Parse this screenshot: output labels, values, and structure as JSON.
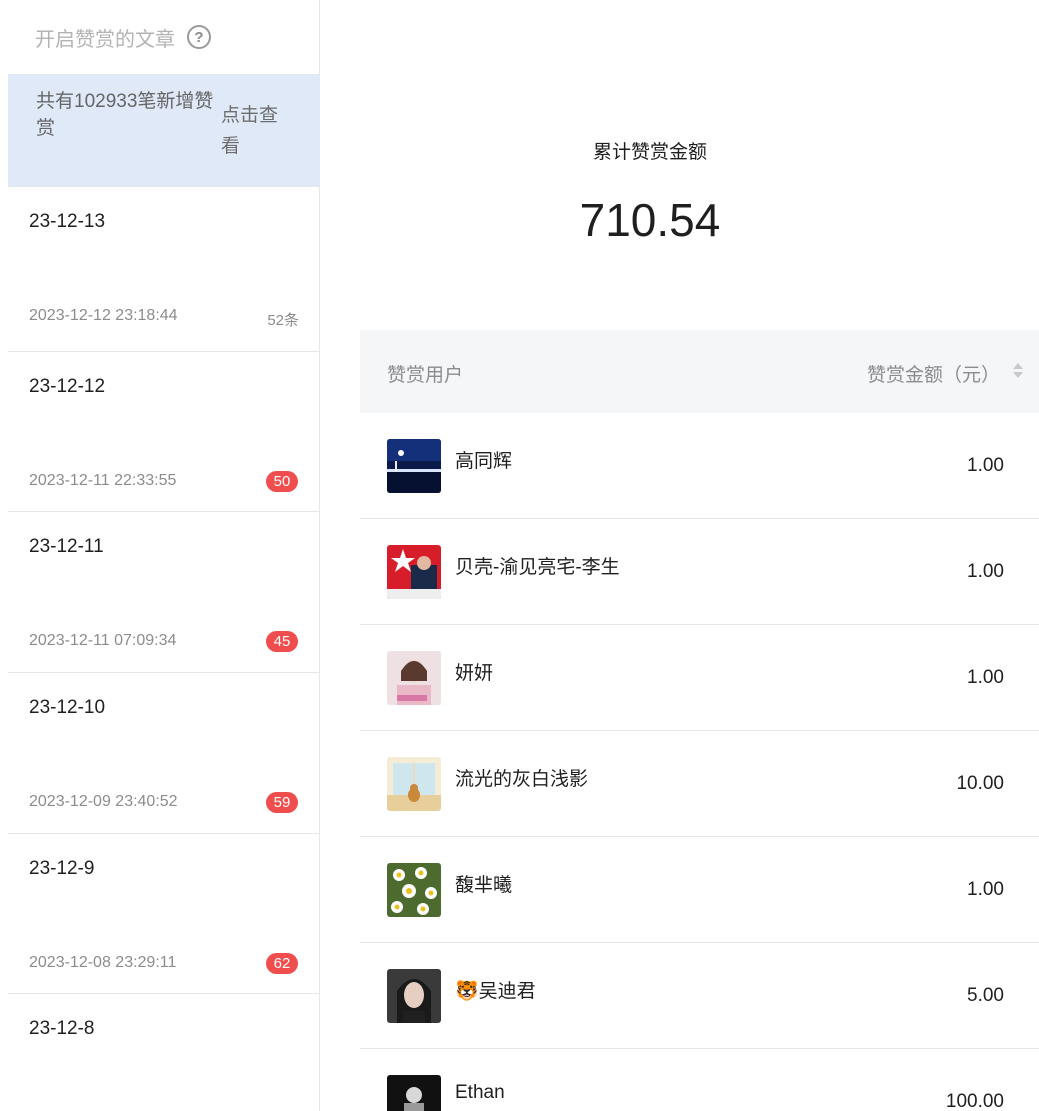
{
  "sidebar": {
    "title": "开启赞赏的文章",
    "help_icon": "question-circle-icon",
    "notice_text": "共有102933笔新增赞赏",
    "notice_link": "点击查看",
    "articles": [
      {
        "title": "23-12-13",
        "time": "2023-12-12 23:18:44",
        "count": "52条"
      },
      {
        "title": "23-12-12",
        "time": "2023-12-11 22:33:55",
        "badge": "50"
      },
      {
        "title": "23-12-11",
        "time": "2023-12-11 07:09:34",
        "badge": "45"
      },
      {
        "title": "23-12-10",
        "time": "2023-12-09 23:40:52",
        "badge": "59"
      },
      {
        "title": "23-12-9",
        "time": "2023-12-08 23:29:11",
        "badge": "62"
      },
      {
        "title": "23-12-8"
      }
    ]
  },
  "summary": {
    "label": "累计赞赏金额",
    "value": "710.54"
  },
  "table": {
    "col_user": "赞赏用户",
    "col_amount": "赞赏金额（元）",
    "rows": [
      {
        "name": "高同辉",
        "amount": "1.00",
        "avatar": "night-bridge-avatar"
      },
      {
        "name": "贝壳-渝见亮宅-李生",
        "amount": "1.00",
        "avatar": "agent-poster-avatar"
      },
      {
        "name": "妍妍",
        "amount": "1.00",
        "avatar": "girl-photo-avatar"
      },
      {
        "name": "流光的灰白浅影",
        "amount": "10.00",
        "avatar": "cat-window-avatar"
      },
      {
        "name": "馥芈曦",
        "amount": "1.00",
        "avatar": "daisy-flowers-avatar"
      },
      {
        "name": "🐯吴迪君",
        "amount": "5.00",
        "avatar": "woman-portrait-avatar"
      },
      {
        "name": "Ethan",
        "amount": "100.00",
        "avatar": "dark-photo-avatar"
      }
    ]
  },
  "colors": {
    "notice_bg": "#dfe9f7",
    "badge_bg": "#f04e4e",
    "table_header_bg": "#f5f6f8"
  }
}
